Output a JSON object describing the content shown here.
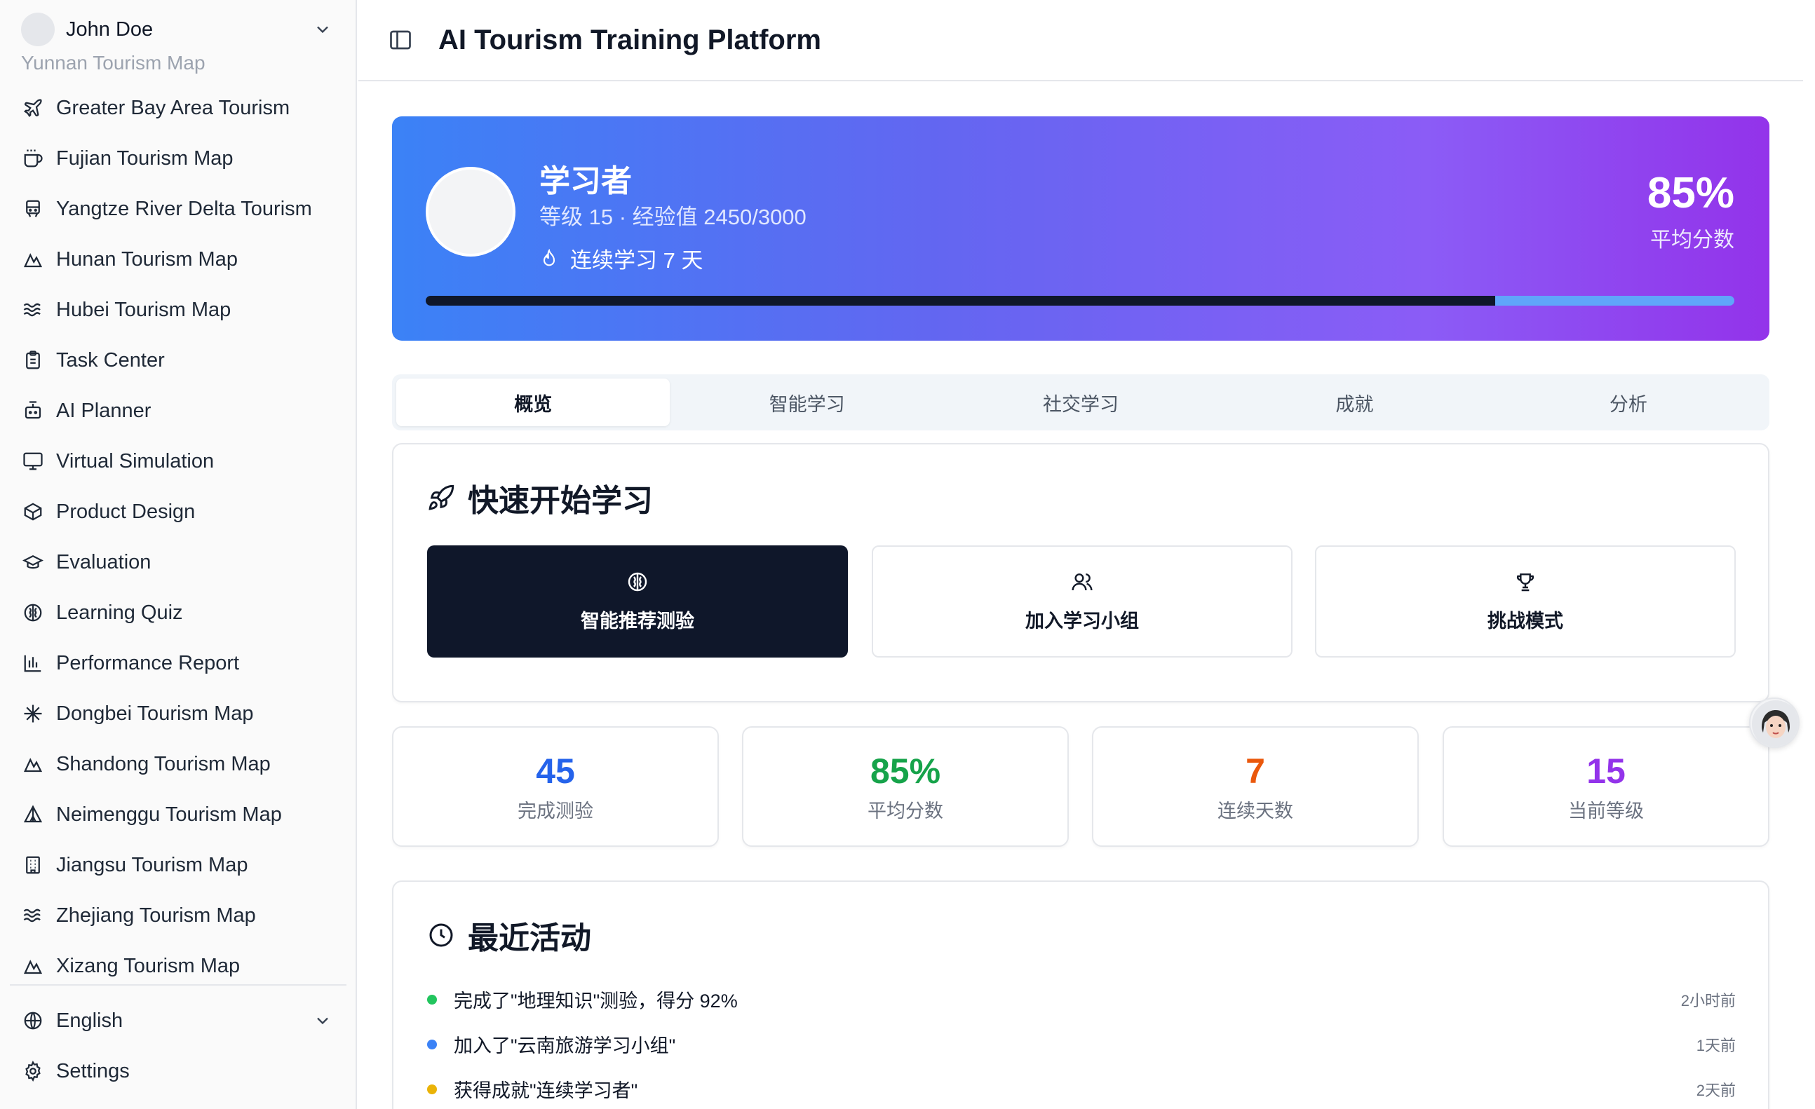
{
  "user": {
    "name": "John Doe"
  },
  "nav": {
    "partial": "Yunnan Tourism Map",
    "items": [
      {
        "label": "Greater Bay Area Tourism",
        "icon": "plane-icon"
      },
      {
        "label": "Fujian Tourism Map",
        "icon": "cup-icon"
      },
      {
        "label": "Yangtze River Delta Tourism",
        "icon": "train-icon"
      },
      {
        "label": "Hunan Tourism Map",
        "icon": "mountain-icon"
      },
      {
        "label": "Hubei Tourism Map",
        "icon": "waves-icon"
      },
      {
        "label": "Task Center",
        "icon": "clipboard-icon"
      },
      {
        "label": "AI Planner",
        "icon": "bot-icon"
      },
      {
        "label": "Virtual Simulation",
        "icon": "monitor-icon"
      },
      {
        "label": "Product Design",
        "icon": "package-icon"
      },
      {
        "label": "Evaluation",
        "icon": "graduation-cap-icon"
      },
      {
        "label": "Learning Quiz",
        "icon": "brain-icon"
      },
      {
        "label": "Performance Report",
        "icon": "bar-chart-icon"
      },
      {
        "label": "Dongbei Tourism Map",
        "icon": "snowflake-icon"
      },
      {
        "label": "Shandong Tourism Map",
        "icon": "mountain-icon"
      },
      {
        "label": "Neimenggu Tourism Map",
        "icon": "tent-icon"
      },
      {
        "label": "Jiangsu Tourism Map",
        "icon": "building-icon"
      },
      {
        "label": "Zhejiang Tourism Map",
        "icon": "waves-icon"
      },
      {
        "label": "Xizang Tourism Map",
        "icon": "mountain-icon"
      }
    ],
    "language": "English",
    "settings": "Settings"
  },
  "header": {
    "title": "AI Tourism Training Platform"
  },
  "profile": {
    "name": "学习者",
    "level_text": "等级 15 · 经验值 2450/3000",
    "streak_text": "连续学习 7 天",
    "score_value": "85%",
    "score_label": "平均分数",
    "progress_fraction": 0.817
  },
  "tabs": [
    "概览",
    "智能学习",
    "社交学习",
    "成就",
    "分析"
  ],
  "quick_start": {
    "title": "快速开始学习",
    "buttons": [
      {
        "label": "智能推荐测验",
        "icon": "brain-icon"
      },
      {
        "label": "加入学习小组",
        "icon": "users-icon"
      },
      {
        "label": "挑战模式",
        "icon": "trophy-icon"
      }
    ]
  },
  "stats": [
    {
      "value": "45",
      "label": "完成测验",
      "color": "#2563eb"
    },
    {
      "value": "85%",
      "label": "平均分数",
      "color": "#16a34a"
    },
    {
      "value": "7",
      "label": "连续天数",
      "color": "#ea580c"
    },
    {
      "value": "15",
      "label": "当前等级",
      "color": "#9333ea"
    }
  ],
  "recent": {
    "title": "最近活动",
    "items": [
      {
        "text": "完成了\"地理知识\"测验，得分 92%",
        "time": "2小时前",
        "color": "#22c55e"
      },
      {
        "text": "加入了\"云南旅游学习小组\"",
        "time": "1天前",
        "color": "#3b82f6"
      },
      {
        "text": "获得成就\"连续学习者\"",
        "time": "2天前",
        "color": "#eab308"
      }
    ]
  }
}
